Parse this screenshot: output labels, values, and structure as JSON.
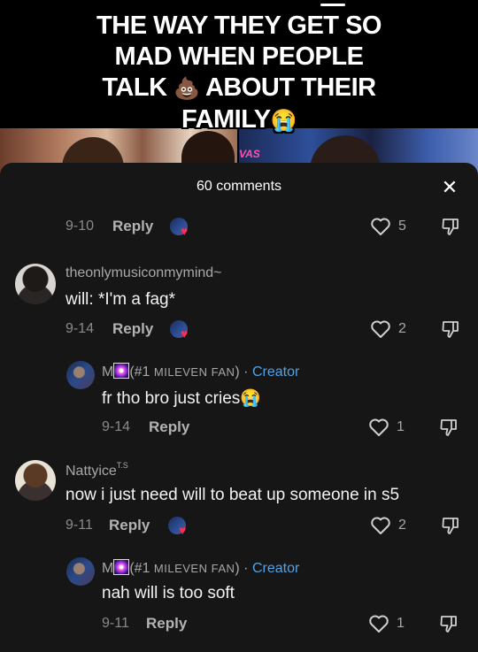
{
  "video": {
    "caption_lines": [
      "THE WAY THEY GET SO",
      "MAD WHEN PEOPLE",
      "TALK",
      "ABOUT THEIR",
      "FAMILY"
    ],
    "poop_emoji": "💩",
    "crying_emoji": "😭",
    "sign_text": "VAS"
  },
  "sheet": {
    "title": "60 comments",
    "close_icon": "✕"
  },
  "colors": {
    "sheet_bg": "#161616",
    "creator_tag": "#4fa3e8",
    "liked_heart": "#ff2d55"
  },
  "comments": [
    {
      "date": "9-10",
      "reply": "Reply",
      "likes": "5"
    },
    {
      "username": "theonlymusiconmymind~",
      "text": "will: *I'm a fag*",
      "date": "9-14",
      "reply": "Reply",
      "likes": "2",
      "replies": [
        {
          "username_prefix": "M",
          "username_mid": "(#1 ",
          "username_fan": "MILEVEN FAN",
          "username_suffix": ")",
          "separator": "·",
          "creator_tag": "Creator",
          "text": "fr tho bro just cries",
          "text_emoji": "😭",
          "date": "9-14",
          "reply": "Reply",
          "likes": "1"
        }
      ]
    },
    {
      "username": "Nattyice",
      "username_sup": "T.S",
      "text": "now i just need will to beat up someone in s5",
      "date": "9-11",
      "reply": "Reply",
      "likes": "2",
      "replies": [
        {
          "username_prefix": "M",
          "username_mid": "(#1 ",
          "username_fan": "MILEVEN FAN",
          "username_suffix": ")",
          "separator": "·",
          "creator_tag": "Creator",
          "text": "nah will is too soft",
          "date": "9-11",
          "reply": "Reply",
          "likes": "1"
        }
      ]
    }
  ]
}
